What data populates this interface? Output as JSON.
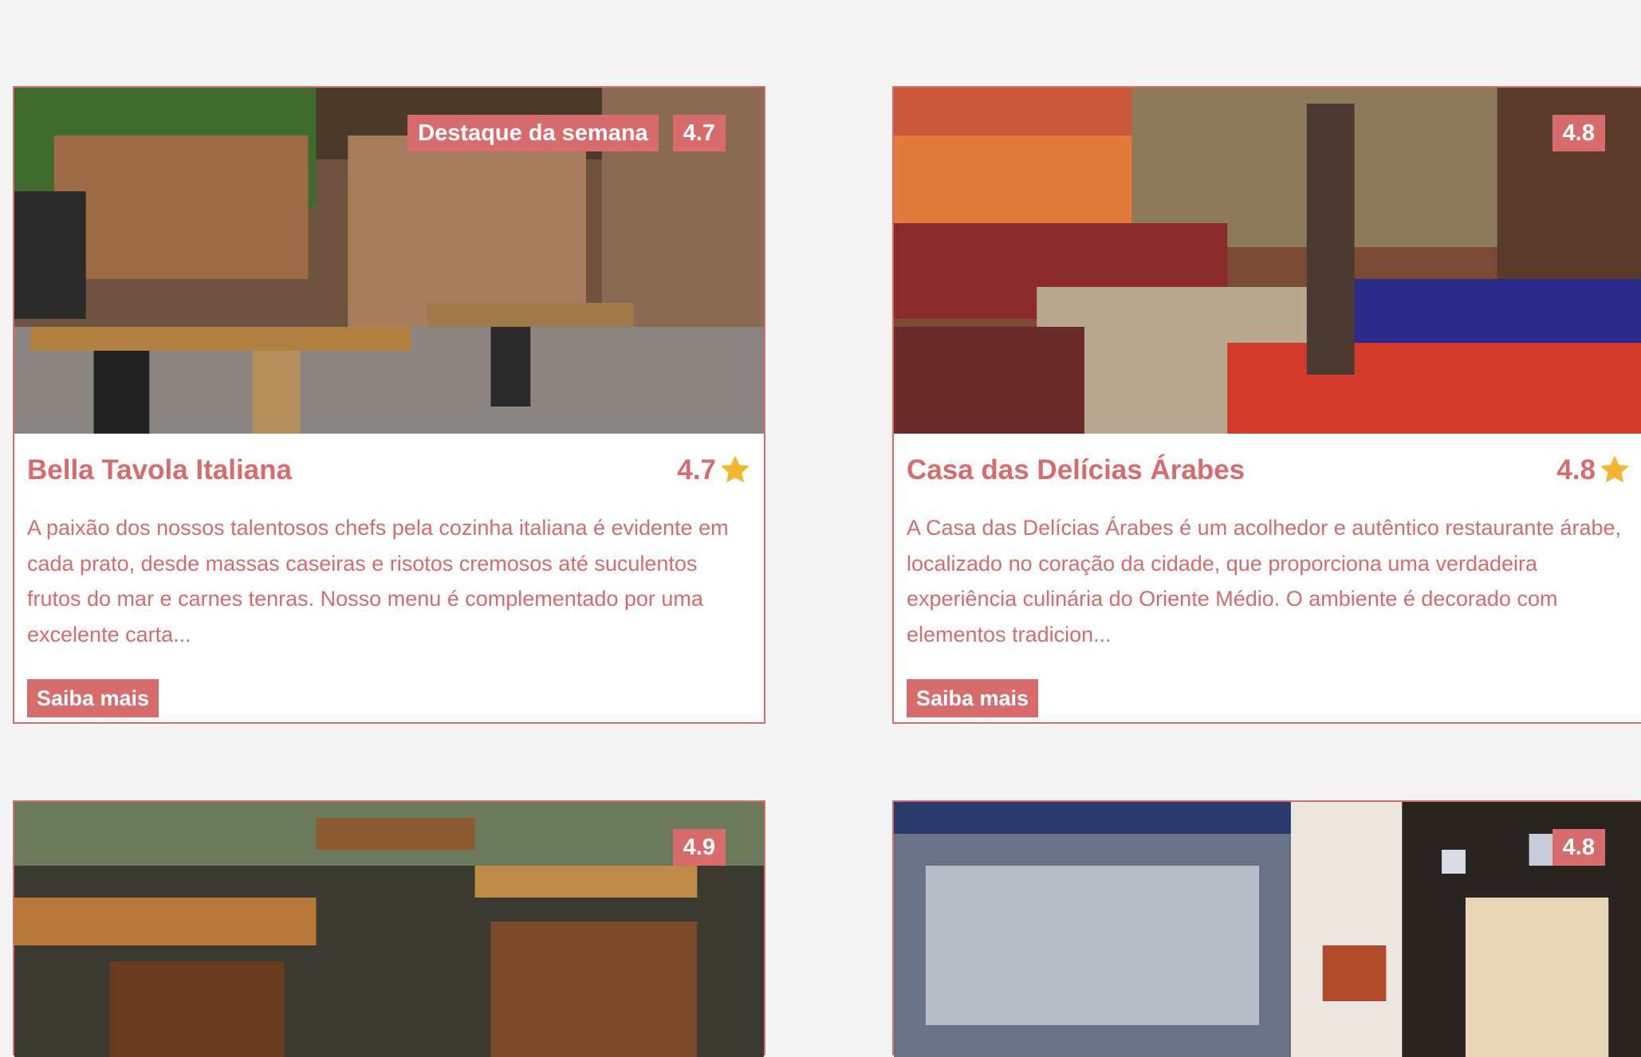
{
  "cards": [
    {
      "badge_feature": "Destaque da semana",
      "badge_rating": "4.7",
      "title": "Bella Tavola Italiana",
      "rating": "4.7",
      "description": "A paixão dos nossos talentosos chefs pela cozinha italiana é evidente em cada prato, desde massas caseiras e risotos cremosos até suculentos frutos do mar e carnes tenras. Nosso menu é complementado por uma excelente carta...",
      "button_label": "Saiba mais"
    },
    {
      "badge_rating": "4.8",
      "title": "Casa das Delícias Árabes",
      "rating": "4.8",
      "description": "A Casa das Delícias Árabes é um acolhedor e autêntico restaurante árabe, localizado no coração da cidade, que proporciona uma verdadeira experiência culinária do Oriente Médio. O ambiente é decorado com elementos tradicion...",
      "button_label": "Saiba mais"
    },
    {
      "badge_rating": "4.9"
    },
    {
      "badge_rating": "4.8"
    }
  ],
  "colors": {
    "accent": "#d86b6b",
    "star": "#f5b52e",
    "background": "#f4f4f4"
  },
  "icons": {
    "rating": "star-icon"
  }
}
